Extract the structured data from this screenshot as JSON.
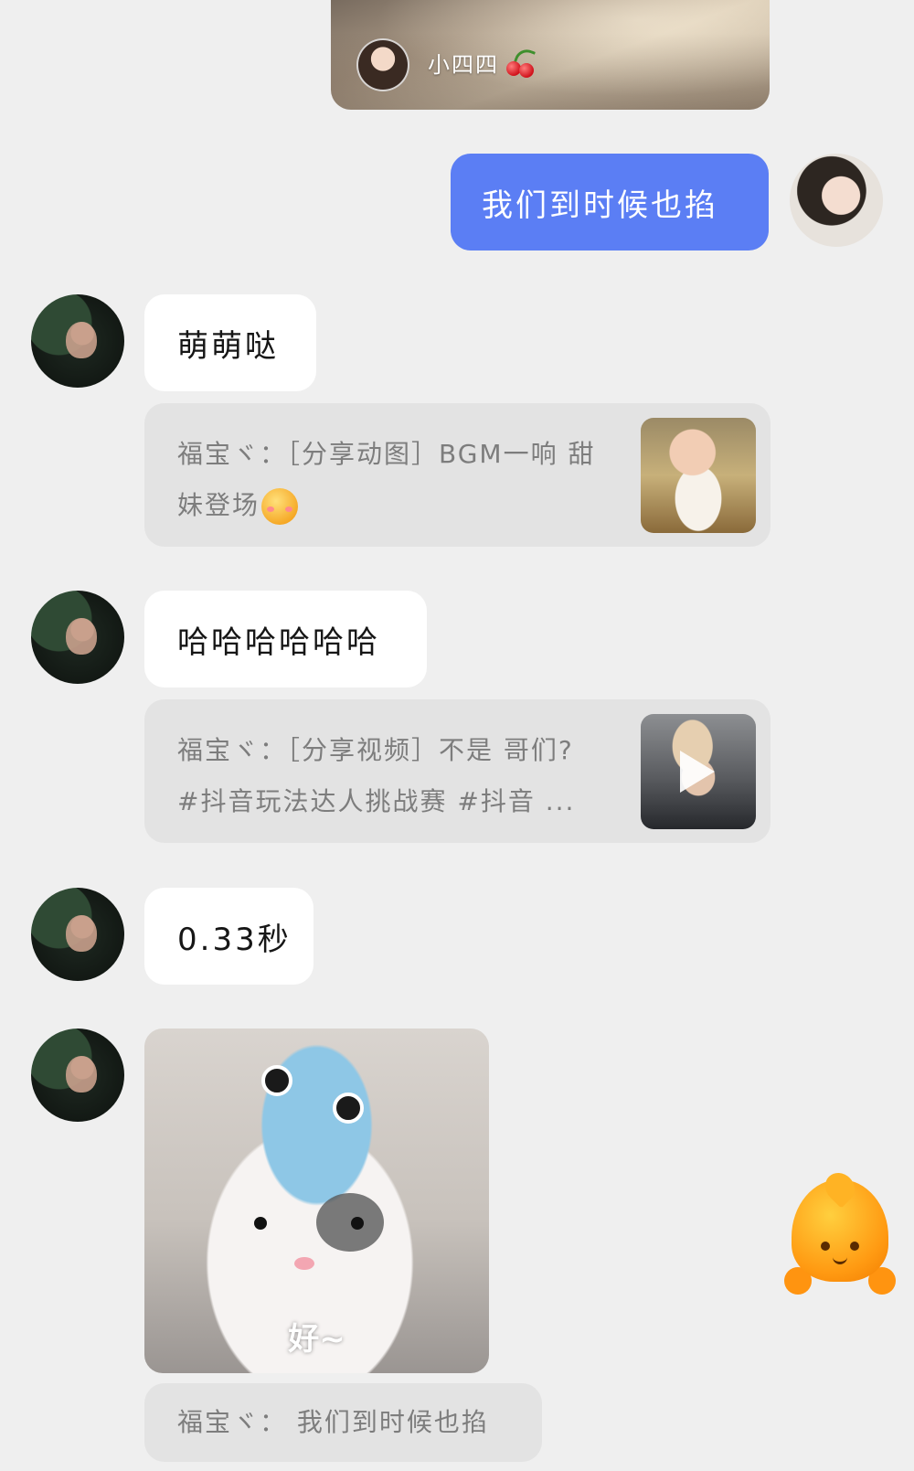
{
  "top_card": {
    "author": "小四四"
  },
  "messages": [
    {
      "from": "me",
      "text": "我们到时候也掐"
    },
    {
      "from": "other",
      "text": "萌萌哒"
    },
    {
      "from": "other",
      "quote_line1": "福宝ヾ：［分享动图］BGM一响 甜",
      "quote_line2": "妹登场"
    },
    {
      "from": "other",
      "text": "哈哈哈哈哈哈"
    },
    {
      "from": "other",
      "quote_line1": "福宝ヾ：［分享视频］不是 哥们?",
      "quote_line2": "#抖音玩法达人挑战赛 #抖音 ..."
    },
    {
      "from": "other",
      "text": "0.33秒"
    },
    {
      "from": "other",
      "sticker_caption": "好~"
    },
    {
      "from": "other",
      "quote_line1": "福宝ヾ：  我们到时候也掐"
    }
  ]
}
